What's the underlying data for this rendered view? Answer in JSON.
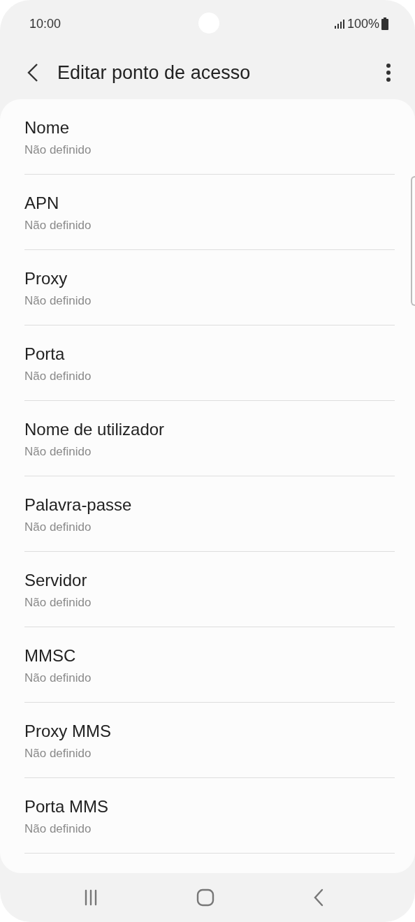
{
  "status_bar": {
    "time": "10:00",
    "battery": "100%"
  },
  "header": {
    "title": "Editar ponto de acesso"
  },
  "settings": [
    {
      "label": "Nome",
      "value": "Não definido"
    },
    {
      "label": "APN",
      "value": "Não definido"
    },
    {
      "label": "Proxy",
      "value": "Não definido"
    },
    {
      "label": "Porta",
      "value": "Não definido"
    },
    {
      "label": "Nome de utilizador",
      "value": "Não definido"
    },
    {
      "label": "Palavra-passe",
      "value": "Não definido"
    },
    {
      "label": "Servidor",
      "value": "Não definido"
    },
    {
      "label": "MMSC",
      "value": "Não definido"
    },
    {
      "label": "Proxy MMS",
      "value": "Não definido"
    },
    {
      "label": "Porta MMS",
      "value": "Não definido"
    }
  ]
}
